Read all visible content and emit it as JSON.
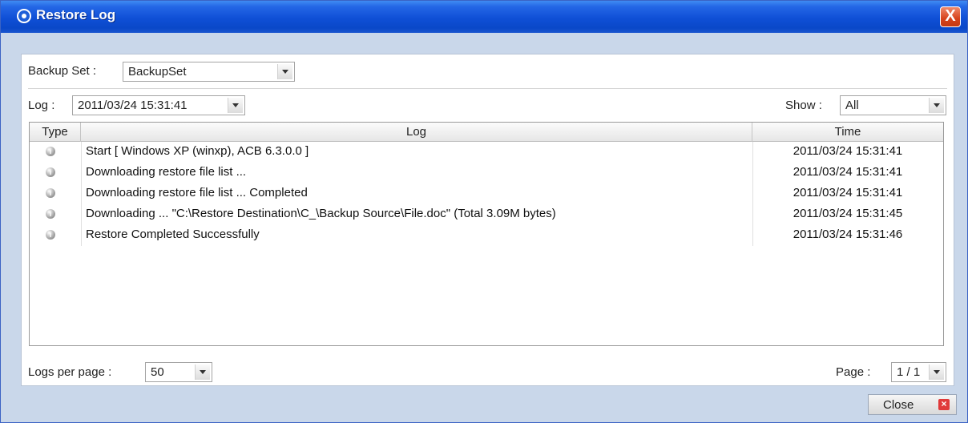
{
  "window": {
    "title": "Restore Log",
    "close_glyph": "X",
    "colors": {
      "titlebar": "#0f4fd6",
      "frame": "#c9d7ea",
      "close": "#d6431c"
    }
  },
  "backup_set": {
    "label": "Backup Set :",
    "value": "BackupSet"
  },
  "log_select": {
    "label": "Log :",
    "value": "2011/03/24 15:31:41"
  },
  "show_select": {
    "label": "Show :",
    "value": "All"
  },
  "table": {
    "columns": {
      "type": "Type",
      "log": "Log",
      "time": "Time"
    },
    "rows": [
      {
        "icon": "info-icon",
        "log": "Start [ Windows XP (winxp), ACB 6.3.0.0 ]",
        "time": "2011/03/24 15:31:41"
      },
      {
        "icon": "info-icon",
        "log": "Downloading restore file list ...",
        "time": "2011/03/24 15:31:41"
      },
      {
        "icon": "info-icon",
        "log": "Downloading restore file list ... Completed",
        "time": "2011/03/24 15:31:41"
      },
      {
        "icon": "info-icon",
        "log": "Downloading ... \"C:\\Restore Destination\\C_\\Backup Source\\File.doc\" (Total 3.09M bytes)",
        "time": "2011/03/24 15:31:45"
      },
      {
        "icon": "info-icon",
        "log": "Restore Completed Successfully",
        "time": "2011/03/24 15:31:46"
      }
    ]
  },
  "footer": {
    "logs_per_page_label": "Logs per page :",
    "logs_per_page_value": "50",
    "page_label": "Page :",
    "page_value": "1 / 1"
  },
  "close_button": {
    "label": "Close",
    "icon": "close-icon"
  }
}
